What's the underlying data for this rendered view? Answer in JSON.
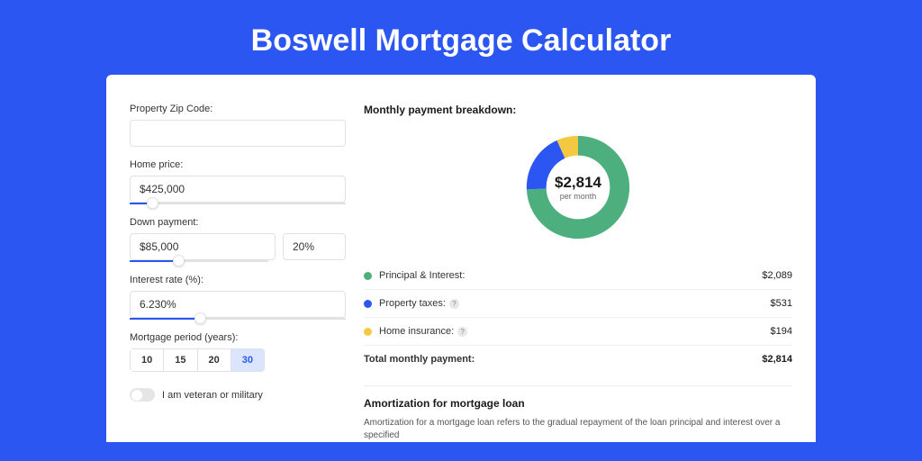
{
  "pageTitle": "Boswell Mortgage Calculator",
  "form": {
    "zip": {
      "label": "Property Zip Code:",
      "value": ""
    },
    "homePrice": {
      "label": "Home price:",
      "value": "$425,000",
      "sliderPct": 8
    },
    "downPayment": {
      "label": "Down payment:",
      "amount": "$85,000",
      "pct": "20%",
      "sliderPct": 20
    },
    "interestRate": {
      "label": "Interest rate (%):",
      "value": "6.230%",
      "sliderPct": 30
    },
    "period": {
      "label": "Mortgage period (years):",
      "options": [
        "10",
        "15",
        "20",
        "30"
      ],
      "selected": "30"
    },
    "veteran": {
      "label": "I am veteran or military",
      "value": false
    }
  },
  "breakdown": {
    "title": "Monthly payment breakdown:",
    "donut": {
      "amount": "$2,814",
      "sub": "per month"
    },
    "rows": [
      {
        "label": "Principal & Interest:",
        "value": "$2,089",
        "color": "green"
      },
      {
        "label": "Property taxes:",
        "value": "$531",
        "color": "blue",
        "info": true
      },
      {
        "label": "Home insurance:",
        "value": "$194",
        "color": "yellow",
        "info": true
      }
    ],
    "total": {
      "label": "Total monthly payment:",
      "value": "$2,814"
    }
  },
  "amort": {
    "title": "Amortization for mortgage loan",
    "text": "Amortization for a mortgage loan refers to the gradual repayment of the loan principal and interest over a specified"
  },
  "chart_data": {
    "type": "pie",
    "title": "Monthly payment breakdown",
    "series": [
      {
        "name": "Principal & Interest",
        "value": 2089,
        "color": "#4caf7d"
      },
      {
        "name": "Property taxes",
        "value": 531,
        "color": "#2c56f2"
      },
      {
        "name": "Home insurance",
        "value": 194,
        "color": "#f5c842"
      }
    ],
    "total": 2814,
    "center_label": "$2,814 per month"
  }
}
